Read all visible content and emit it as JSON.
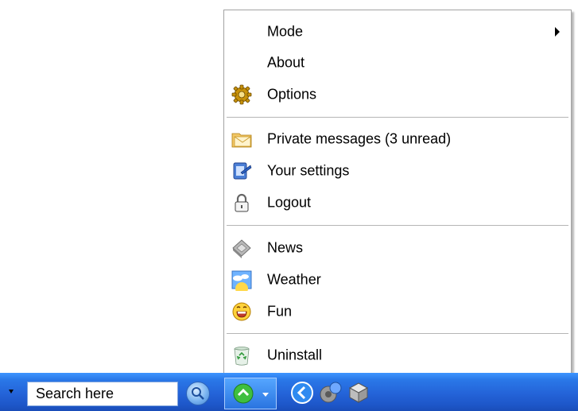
{
  "menu": {
    "items": [
      {
        "label": "Mode",
        "icon": "none",
        "submenu": true
      },
      {
        "label": "About",
        "icon": "none"
      },
      {
        "label": "Options",
        "icon": "gear-icon"
      },
      {
        "label": "Private messages (3 unread)",
        "icon": "envelope-icon"
      },
      {
        "label": "Your settings",
        "icon": "settings-icon"
      },
      {
        "label": "Logout",
        "icon": "padlock-icon"
      },
      {
        "label": "News",
        "icon": "news-icon"
      },
      {
        "label": "Weather",
        "icon": "weather-icon"
      },
      {
        "label": "Fun",
        "icon": "smiley-icon"
      },
      {
        "label": "Uninstall",
        "icon": "recycle-bin-icon"
      }
    ]
  },
  "taskbar": {
    "search_placeholder": "Search here",
    "colors": {
      "taskbar": "#2463d8",
      "accent": "#3d95ff"
    }
  }
}
